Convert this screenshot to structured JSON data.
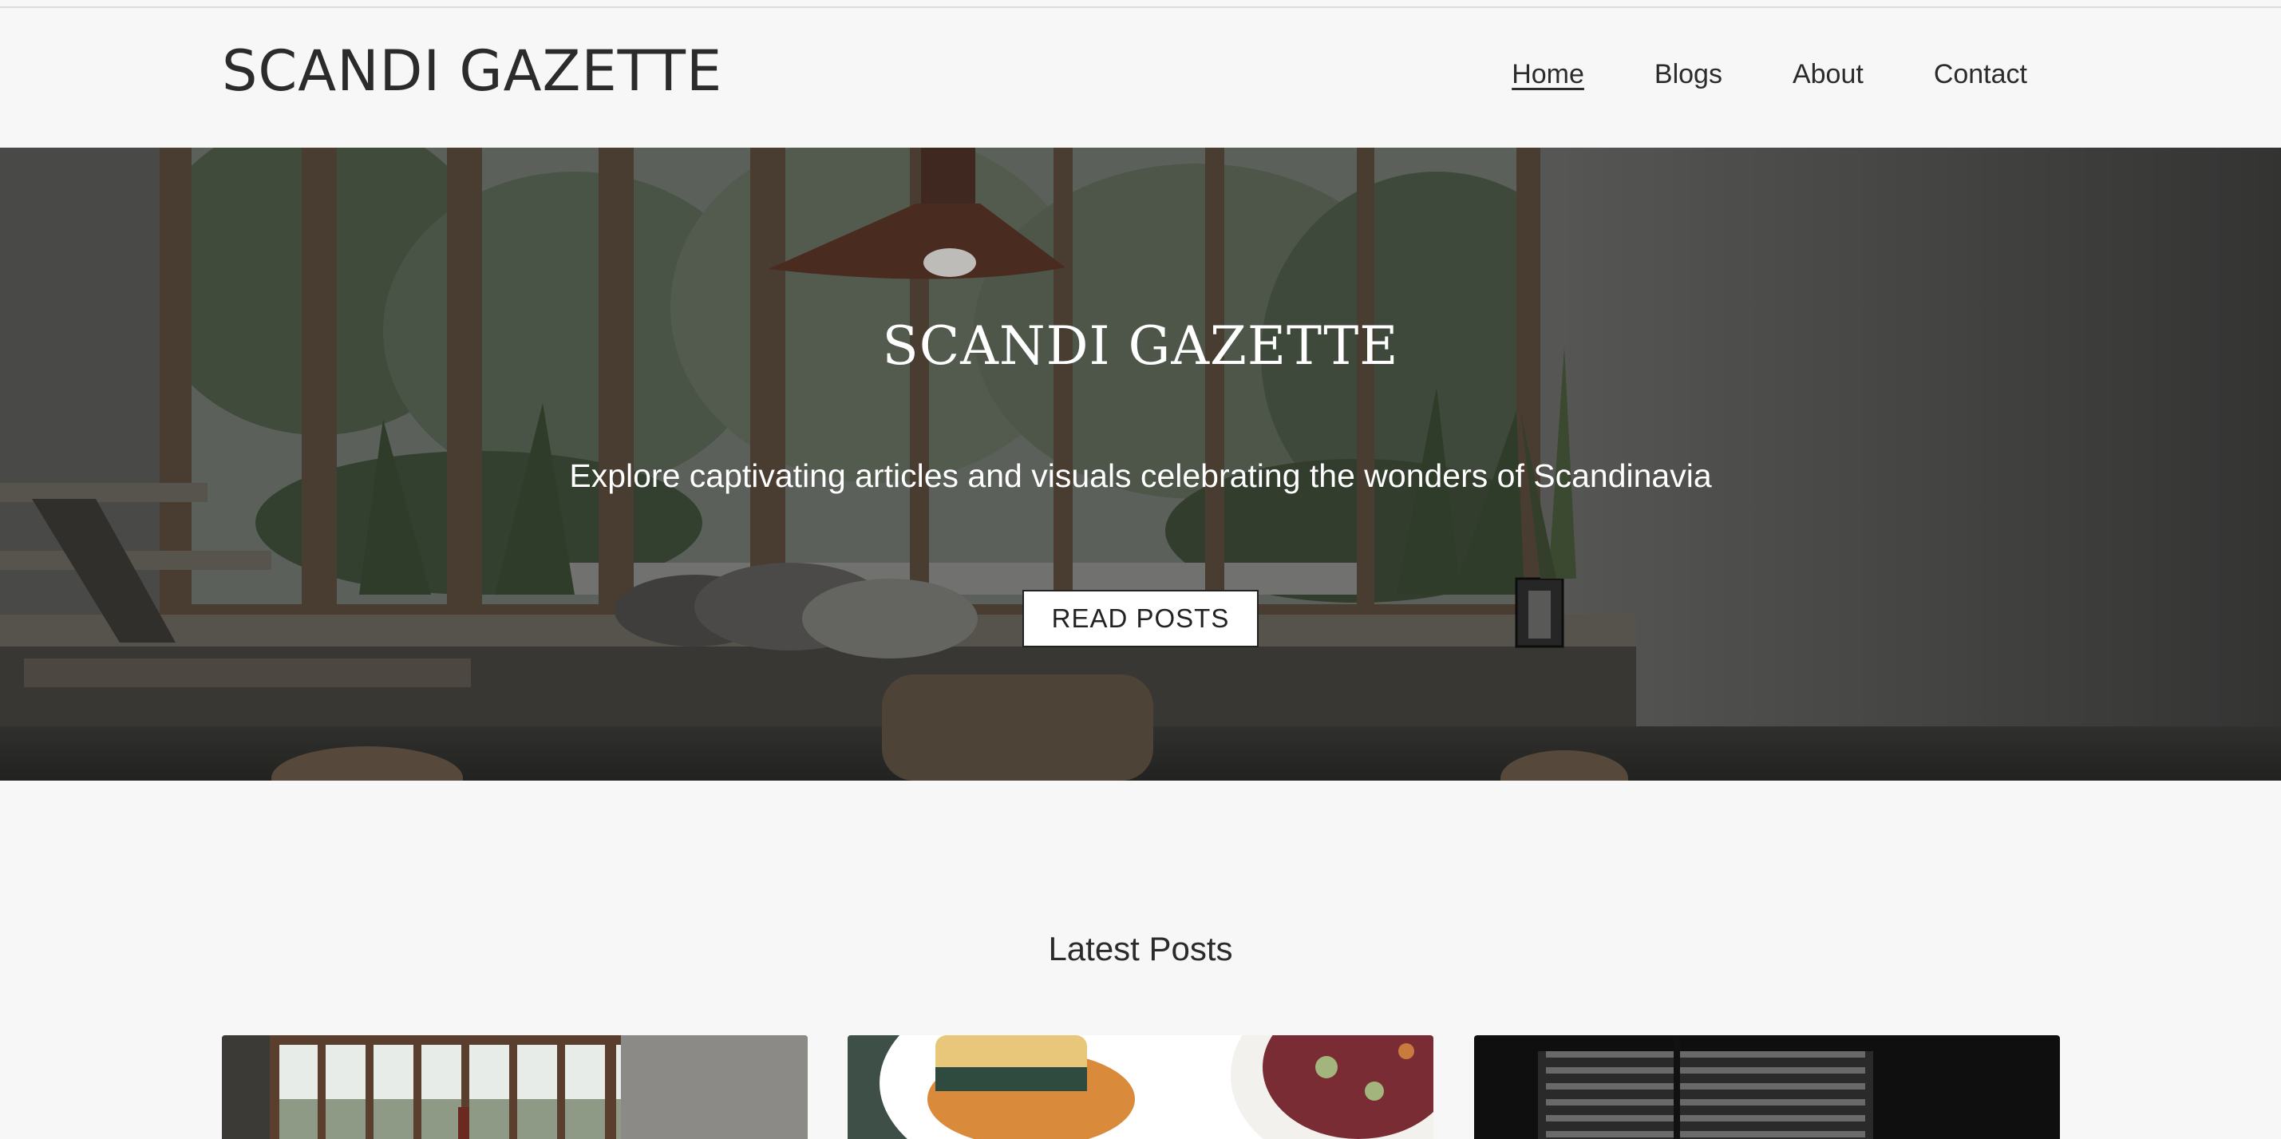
{
  "site": {
    "brand": "SCANDI GAZETTE"
  },
  "nav": {
    "items": [
      {
        "label": "Home",
        "active": true
      },
      {
        "label": "Blogs",
        "active": false
      },
      {
        "label": "About",
        "active": false
      },
      {
        "label": "Contact",
        "active": false
      }
    ]
  },
  "hero": {
    "title": "SCANDI GAZETTE",
    "subtitle": "Explore captivating articles and visuals celebrating the wonders of Scandinavia",
    "button_label": "READ POSTS"
  },
  "latest": {
    "title": "Latest Posts",
    "cards": [
      {
        "image": "interior-window-photo"
      },
      {
        "image": "plated-food-photo"
      },
      {
        "image": "dark-window-shadow-photo"
      }
    ]
  },
  "colors": {
    "text": "#2b2b2b",
    "background": "#f7f7f7",
    "hero_text": "#ffffff"
  }
}
